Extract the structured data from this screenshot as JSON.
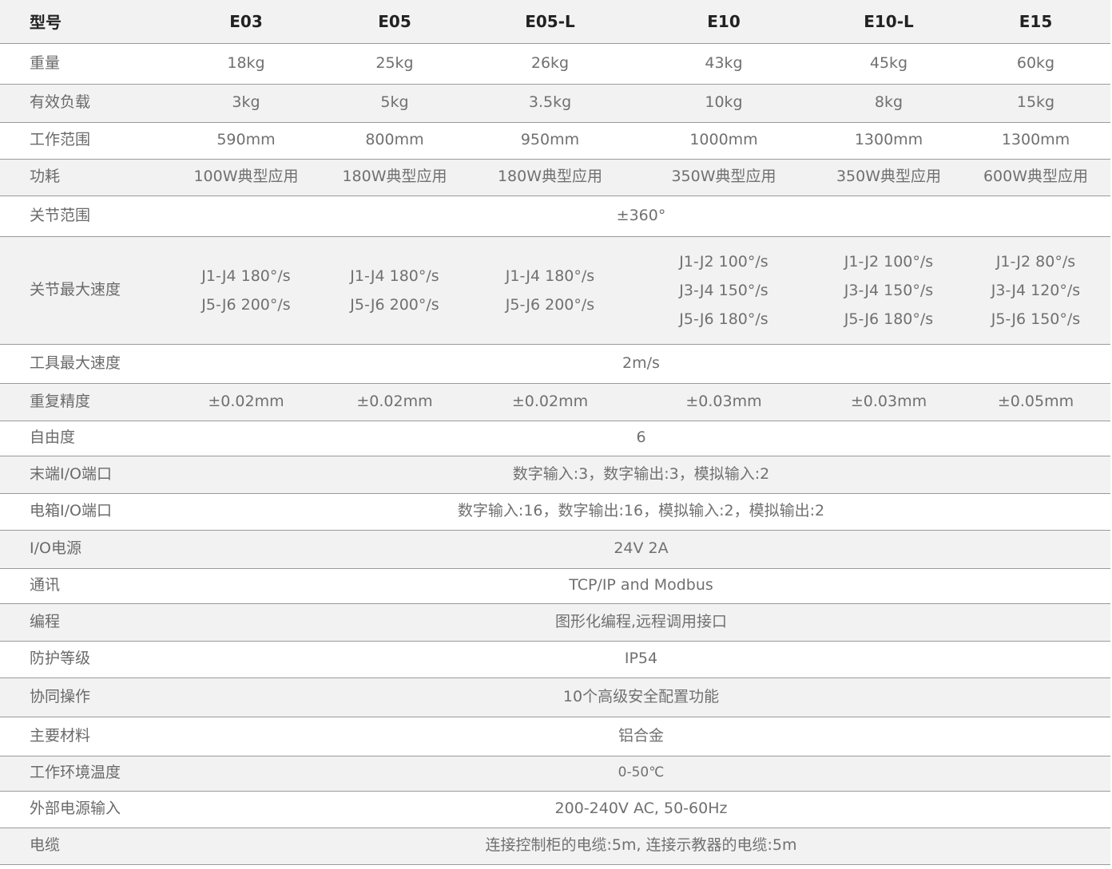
{
  "header": {
    "label": "型号",
    "models": [
      "E03",
      "E05",
      "E05-L",
      "E10",
      "E10-L",
      "E15"
    ]
  },
  "rows": {
    "weight": {
      "label": "重量",
      "values": [
        "18kg",
        "25kg",
        "26kg",
        "43kg",
        "45kg",
        "60kg"
      ]
    },
    "payload": {
      "label": "有效负载",
      "values": [
        "3kg",
        "5kg",
        "3.5kg",
        "10kg",
        "8kg",
        "15kg"
      ]
    },
    "reach": {
      "label": "工作范围",
      "values": [
        "590mm",
        "800mm",
        "950mm",
        "1000mm",
        "1300mm",
        "1300mm"
      ]
    },
    "power": {
      "label": "功耗",
      "values": [
        "100W典型应用",
        "180W典型应用",
        "180W典型应用",
        "350W典型应用",
        "350W典型应用",
        "600W典型应用"
      ]
    },
    "joint_range": {
      "label": "关节范围",
      "value": "±360°"
    },
    "joint_speed": {
      "label": "关节最大速度",
      "values": [
        [
          "J1-J4 180°/s",
          "J5-J6 200°/s"
        ],
        [
          "J1-J4 180°/s",
          "J5-J6 200°/s"
        ],
        [
          "J1-J4 180°/s",
          "J5-J6 200°/s"
        ],
        [
          "J1-J2 100°/s",
          "J3-J4 150°/s",
          "J5-J6 180°/s"
        ],
        [
          "J1-J2 100°/s",
          "J3-J4 150°/s",
          "J5-J6 180°/s"
        ],
        [
          "J1-J2 80°/s",
          "J3-J4 120°/s",
          "J5-J6 150°/s"
        ]
      ]
    },
    "tool_speed": {
      "label": "工具最大速度",
      "value": "2m/s"
    },
    "repeatability": {
      "label": "重复精度",
      "values": [
        "±0.02mm",
        "±0.02mm",
        "±0.02mm",
        "±0.03mm",
        "±0.03mm",
        "±0.05mm"
      ]
    },
    "dof": {
      "label": "自由度",
      "value": "6"
    },
    "tool_io": {
      "label": "末端I/O端口",
      "value": "数字输入:3，数字输出:3，模拟输入:2"
    },
    "box_io": {
      "label": "电箱I/O端口",
      "value": "数字输入:16，数字输出:16，模拟输入:2，模拟输出:2"
    },
    "io_power": {
      "label": "I/O电源",
      "value": "24V 2A"
    },
    "comm": {
      "label": "通讯",
      "value": "TCP/IP and Modbus"
    },
    "programming": {
      "label": "编程",
      "value": "图形化编程,远程调用接口"
    },
    "ip_rating": {
      "label": "防护等级",
      "value": "IP54"
    },
    "collab": {
      "label": "协同操作",
      "value": "10个高级安全配置功能"
    },
    "material": {
      "label": "主要材料",
      "value": "铝合金"
    },
    "temp": {
      "label": "工作环境温度",
      "value": "0-50℃"
    },
    "ext_power": {
      "label": "外部电源输入",
      "value": "200-240V AC, 50-60Hz"
    },
    "cable": {
      "label": "电缆",
      "value": "连接控制柜的电缆:5m, 连接示教器的电缆:5m"
    }
  }
}
